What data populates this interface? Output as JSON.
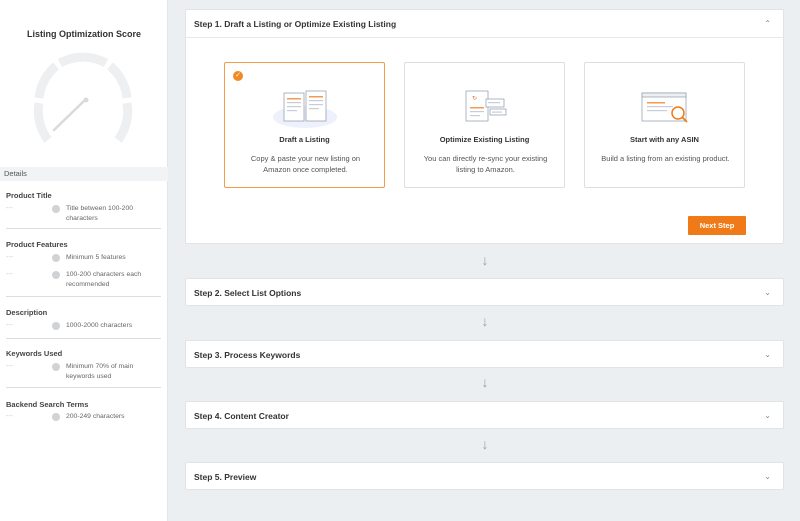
{
  "sidebar": {
    "score_title": "Listing Optimization Score",
    "details_label": "Details",
    "sections": [
      {
        "title": "Product Title",
        "requirements": [
          "Title between 100-200 characters"
        ]
      },
      {
        "title": "Product Features",
        "requirements": [
          "Minimum 5 features",
          "100-200 characters each recommended"
        ]
      },
      {
        "title": "Description",
        "requirements": [
          "1000-2000 characters"
        ]
      },
      {
        "title": "Keywords Used",
        "requirements": [
          "Minimum 70% of main keywords used"
        ]
      },
      {
        "title": "Backend Search Terms",
        "requirements": [
          "200-249 characters"
        ]
      }
    ],
    "dash": "---"
  },
  "steps": [
    {
      "title": "Step 1. Draft a Listing or Optimize Existing Listing",
      "expanded": true
    },
    {
      "title": "Step 2. Select List Options",
      "expanded": false
    },
    {
      "title": "Step 3. Process Keywords",
      "expanded": false
    },
    {
      "title": "Step 4. Content Creator",
      "expanded": false
    },
    {
      "title": "Step 5. Preview",
      "expanded": false
    }
  ],
  "options": [
    {
      "title": "Draft a Listing",
      "desc": "Copy & paste your new listing on Amazon once completed.",
      "selected": true,
      "icon": "documents-icon"
    },
    {
      "title": "Optimize Existing Listing",
      "desc": "You can directly re-sync your existing listing to Amazon.",
      "selected": false,
      "icon": "sync-document-icon"
    },
    {
      "title": "Start with any ASIN",
      "desc": "Build a listing from an existing product.",
      "selected": false,
      "icon": "search-browser-icon"
    }
  ],
  "next_button": "Next Step",
  "icons": {
    "collapse": "chevron-up-icon",
    "expand": "chevron-down-icon",
    "arrow": "arrow-down-icon",
    "check": "check-icon"
  },
  "colors": {
    "accent": "#f07a17",
    "background": "#eceff1"
  }
}
